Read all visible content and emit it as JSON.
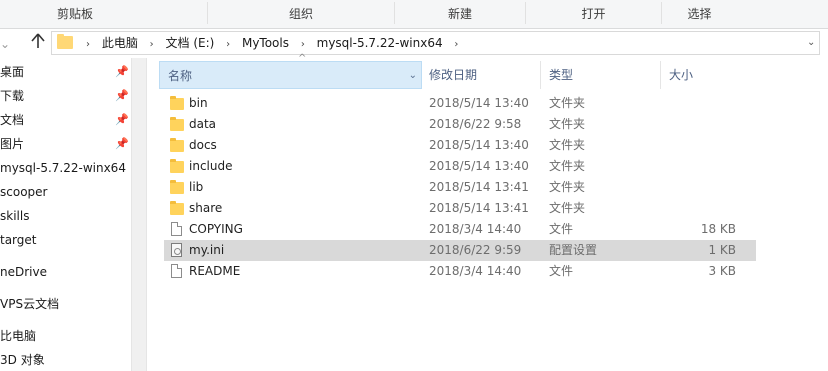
{
  "ribbon": {
    "groups": [
      "剪贴板",
      "组织",
      "新建",
      "打开",
      "选择"
    ]
  },
  "address": {
    "crumbs": [
      "此电脑",
      "文档 (E:)",
      "MyTools",
      "mysql-5.7.22-winx64"
    ]
  },
  "icons": {
    "up": "up-arrow-icon",
    "folder": "folder-icon",
    "pin": "pin-icon",
    "file": "file-icon",
    "config": "config-file-icon"
  },
  "sidebar": {
    "items": [
      {
        "label": "桌面",
        "pinned": true
      },
      {
        "label": "下载",
        "pinned": true
      },
      {
        "label": "文档",
        "pinned": true
      },
      {
        "label": "图片",
        "pinned": true
      },
      {
        "label": "mysql-5.7.22-winx64",
        "pinned": false
      },
      {
        "label": "scooper",
        "pinned": false
      },
      {
        "label": "skills",
        "pinned": false
      },
      {
        "label": "target",
        "pinned": false
      },
      {
        "label": "neDrive",
        "pinned": false
      },
      {
        "label": "VPS云文档",
        "pinned": false
      },
      {
        "label": "比电脑",
        "pinned": false
      },
      {
        "label": "3D 对象",
        "pinned": false
      }
    ]
  },
  "columns": {
    "name": "名称",
    "modified": "修改日期",
    "type": "类型",
    "size": "大小"
  },
  "files": [
    {
      "name": "bin",
      "modified": "2018/5/14 13:40",
      "type": "文件夹",
      "size": "",
      "kind": "folder"
    },
    {
      "name": "data",
      "modified": "2018/6/22 9:58",
      "type": "文件夹",
      "size": "",
      "kind": "folder"
    },
    {
      "name": "docs",
      "modified": "2018/5/14 13:40",
      "type": "文件夹",
      "size": "",
      "kind": "folder"
    },
    {
      "name": "include",
      "modified": "2018/5/14 13:40",
      "type": "文件夹",
      "size": "",
      "kind": "folder"
    },
    {
      "name": "lib",
      "modified": "2018/5/14 13:41",
      "type": "文件夹",
      "size": "",
      "kind": "folder"
    },
    {
      "name": "share",
      "modified": "2018/5/14 13:41",
      "type": "文件夹",
      "size": "",
      "kind": "folder"
    },
    {
      "name": "COPYING",
      "modified": "2018/3/4 14:40",
      "type": "文件",
      "size": "18 KB",
      "kind": "file"
    },
    {
      "name": "my.ini",
      "modified": "2018/6/22 9:59",
      "type": "配置设置",
      "size": "1 KB",
      "kind": "ini",
      "selected": true
    },
    {
      "name": "README",
      "modified": "2018/3/4 14:40",
      "type": "文件",
      "size": "3 KB",
      "kind": "file"
    }
  ]
}
